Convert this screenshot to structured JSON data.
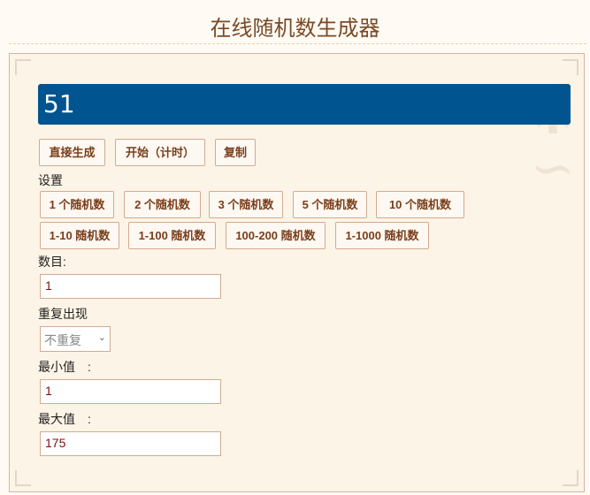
{
  "title": "在线随机数生成器",
  "result": "51",
  "actions": [
    "直接生成",
    "开始（计时）",
    "复制"
  ],
  "settings_label": "设置",
  "count_presets": [
    "1 个随机数",
    "2 个随机数",
    "3 个随机数",
    "5 个随机数",
    "10 个随机数"
  ],
  "range_presets": [
    "1-10 随机数",
    "1-100 随机数",
    "100-200 随机数",
    "1-1000 随机数"
  ],
  "count_label": "数目:",
  "count_value": "1",
  "repeat_label": "重复出现",
  "repeat_value": "不重复",
  "min_label": "最小值　:",
  "min_value": "1",
  "max_label": "最大值　:",
  "max_value": "175"
}
